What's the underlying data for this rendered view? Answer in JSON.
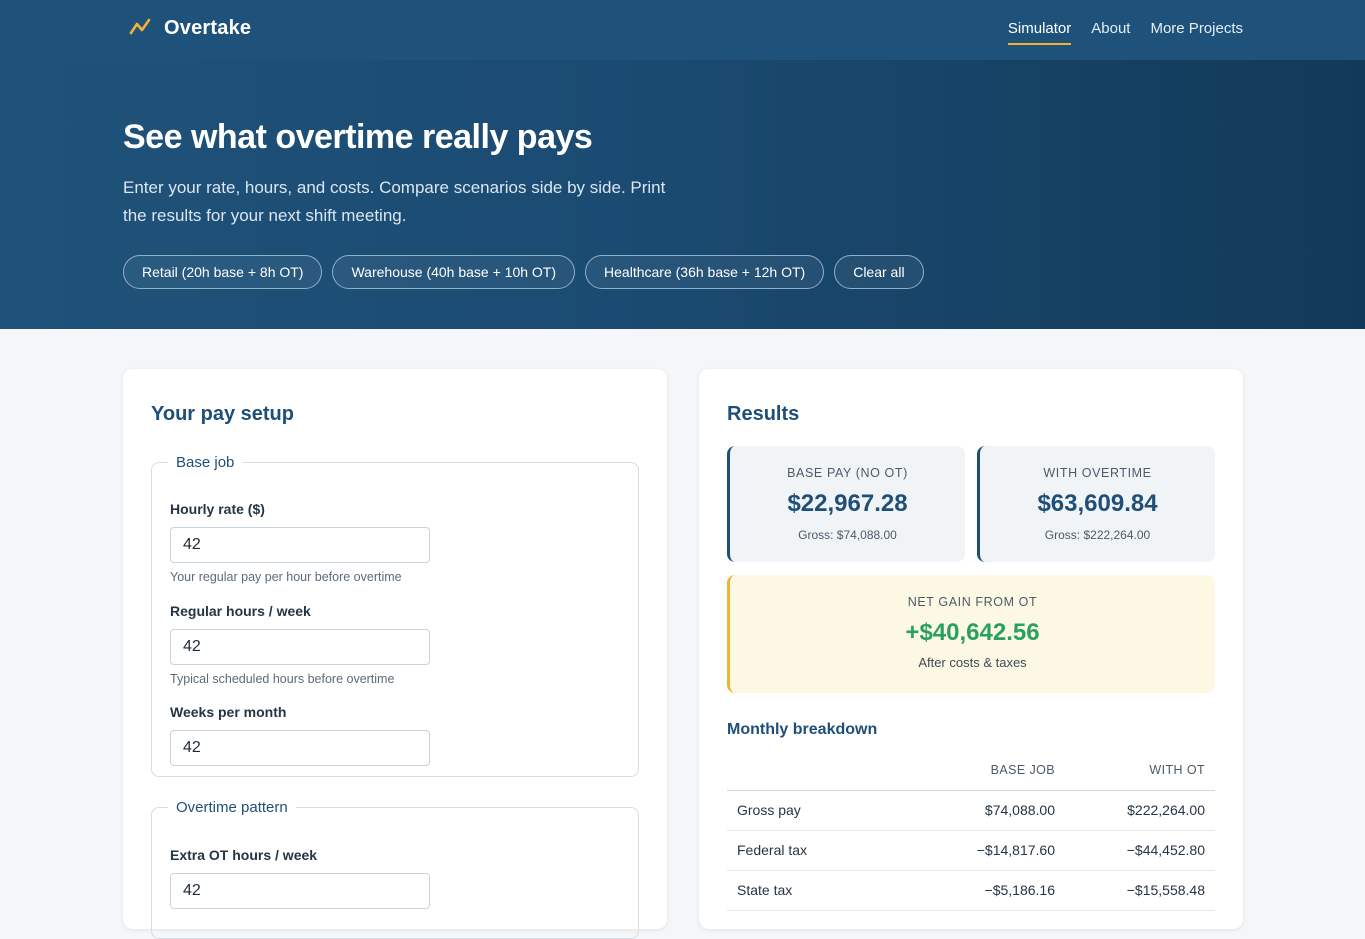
{
  "nav": {
    "brand": "Overtake",
    "links": [
      "Simulator",
      "About",
      "More Projects"
    ]
  },
  "hero": {
    "title": "See what overtime really pays",
    "subtitle": "Enter your rate, hours, and costs. Compare scenarios side by side. Print the results for your next shift meeting.",
    "presets": [
      "Retail (20h base + 8h OT)",
      "Warehouse (40h base + 10h OT)",
      "Healthcare (36h base + 12h OT)",
      "Clear all"
    ]
  },
  "setup": {
    "title": "Your pay setup",
    "base_group": "Base job",
    "hourly_rate": {
      "label": "Hourly rate ($)",
      "value": "42",
      "help": "Your regular pay per hour before overtime"
    },
    "regular_hours": {
      "label": "Regular hours / week",
      "value": "42",
      "help": "Typical scheduled hours before overtime"
    },
    "weeks_per_month": {
      "label": "Weeks per month",
      "value": "42"
    },
    "ot_group": "Overtime pattern",
    "extra_ot_hours": {
      "label": "Extra OT hours / week",
      "value": "42"
    }
  },
  "results": {
    "title": "Results",
    "base": {
      "label": "BASE PAY (NO OT)",
      "value": "$22,967.28",
      "gross": "Gross: $74,088.00"
    },
    "ot": {
      "label": "WITH OVERTIME",
      "value": "$63,609.84",
      "gross": "Gross: $222,264.00"
    },
    "net": {
      "label": "NET GAIN FROM OT",
      "value": "+$40,642.56",
      "sub": "After costs & taxes"
    },
    "breakdown": {
      "title": "Monthly breakdown",
      "columns": [
        "",
        "BASE JOB",
        "WITH OT"
      ],
      "rows": [
        {
          "label": "Gross pay",
          "base": "$74,088.00",
          "ot": "$222,264.00"
        },
        {
          "label": "Federal tax",
          "base": "−$14,817.60",
          "ot": "−$44,452.80"
        },
        {
          "label": "State tax",
          "base": "−$5,186.16",
          "ot": "−$15,558.48"
        }
      ]
    }
  },
  "colors": {
    "header": "#1f527a",
    "accent": "#f2b233",
    "primary_text": "#1f4f78",
    "positive": "#27a060"
  }
}
